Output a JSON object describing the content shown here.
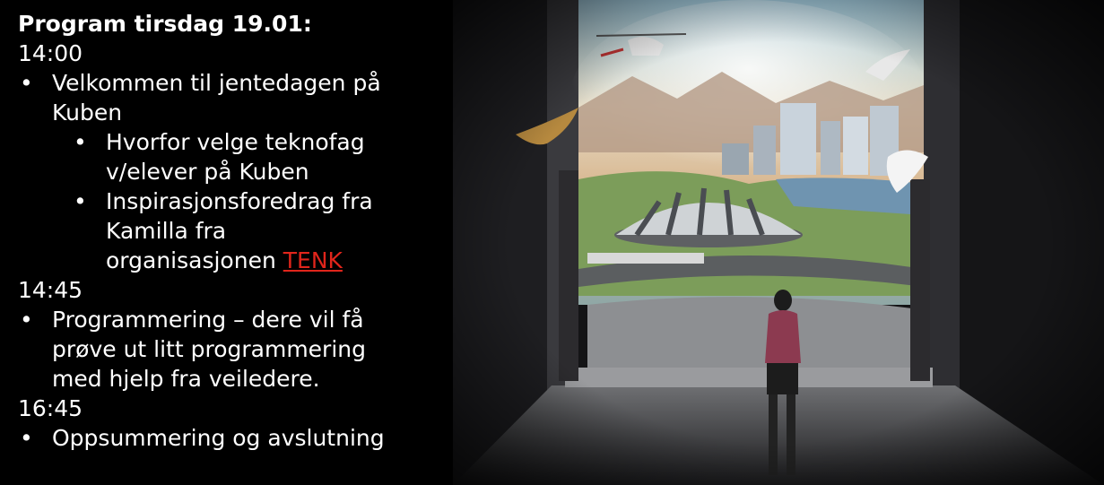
{
  "slide": {
    "title": "Program tirsdag 19.01:",
    "blocks": [
      {
        "time": "14:00",
        "items": [
          {
            "text": "Velkommen til jentedagen på Kuben",
            "subitems": [
              {
                "text": "Hvorfor velge teknofag v/elever på Kuben"
              },
              {
                "text_before": "Inspirasjonsforedrag fra Kamilla fra organisasjonen ",
                "link": "TENK"
              }
            ]
          }
        ]
      },
      {
        "time": "14:45",
        "items": [
          {
            "text": "Programmering – dere vil få prøve ut litt programmering med hjelp fra veiledere."
          }
        ]
      },
      {
        "time": "16:45",
        "items": [
          {
            "text": "Oppsummering og avslutning"
          }
        ]
      }
    ]
  },
  "colors": {
    "background": "#000000",
    "text": "#ffffff",
    "link": "#e0251b"
  },
  "image": {
    "icon": "doorway-city-illustration"
  }
}
